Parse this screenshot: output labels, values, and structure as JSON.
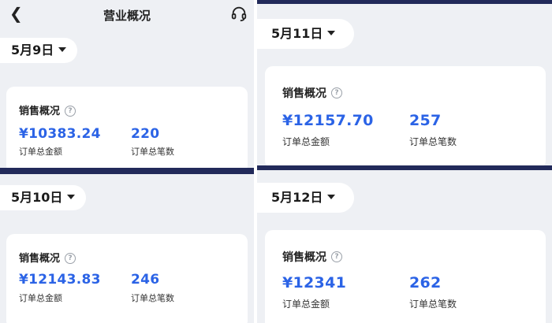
{
  "header": {
    "back_icon": "chevron-left-icon",
    "title": "营业概况",
    "service_icon": "headset-icon"
  },
  "colors": {
    "accent": "#2b63e6",
    "background": "#eef0f4",
    "divider": "#222a5a"
  },
  "panels": [
    {
      "date": "5月9日",
      "section_title": "销售概况",
      "amount": "¥10383.24",
      "amount_label": "订单总金额",
      "count": "220",
      "count_label": "订单总笔数"
    },
    {
      "date": "5月10日",
      "section_title": "销售概况",
      "amount": "¥12143.83",
      "amount_label": "订单总金额",
      "count": "246",
      "count_label": "订单总笔数"
    },
    {
      "date": "5月11日",
      "section_title": "销售概况",
      "amount": "¥12157.70",
      "amount_label": "订单总金额",
      "count": "257",
      "count_label": "订单总笔数"
    },
    {
      "date": "5月12日",
      "section_title": "销售概况",
      "amount": "¥12341",
      "amount_label": "订单总金额",
      "count": "262",
      "count_label": "订单总笔数"
    }
  ]
}
